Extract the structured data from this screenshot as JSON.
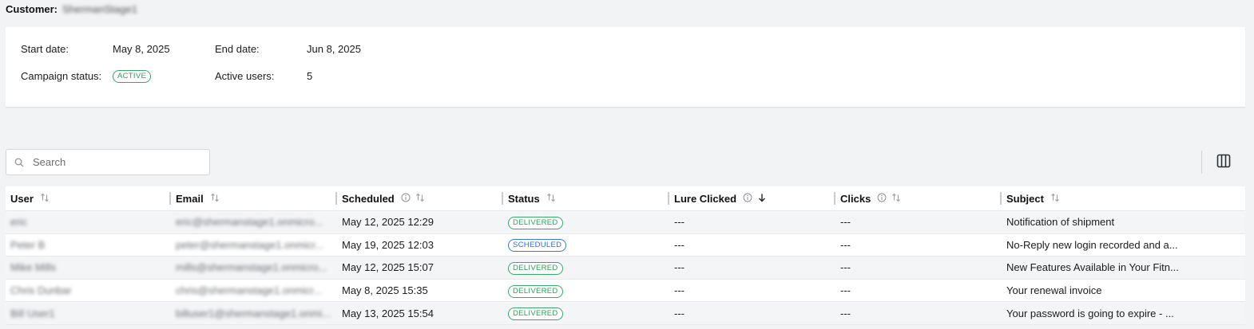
{
  "customer": {
    "label": "Customer:",
    "name": "ShermanStage1"
  },
  "summary": {
    "start_label": "Start date:",
    "start_value": "May 8, 2025",
    "end_label": "End date:",
    "end_value": "Jun 8, 2025",
    "status_label": "Campaign status:",
    "status_value": "ACTIVE",
    "active_users_label": "Active users:",
    "active_users_value": "5"
  },
  "search": {
    "placeholder": "Search"
  },
  "table": {
    "columns": [
      {
        "label": "User",
        "info": false,
        "sort": "none"
      },
      {
        "label": "Email",
        "info": false,
        "sort": "none"
      },
      {
        "label": "Scheduled",
        "info": true,
        "sort": "none"
      },
      {
        "label": "Status",
        "info": false,
        "sort": "none"
      },
      {
        "label": "Lure Clicked",
        "info": true,
        "sort": "desc"
      },
      {
        "label": "Clicks",
        "info": true,
        "sort": "none"
      },
      {
        "label": "Subject",
        "info": false,
        "sort": "none"
      }
    ],
    "rows": [
      {
        "user": "eric",
        "email": "eric@shermanstage1.onmicro...",
        "scheduled": "May 12, 2025 12:29",
        "status": "DELIVERED",
        "lure_clicked": "---",
        "clicks": "---",
        "subject": "Notification of shipment"
      },
      {
        "user": "Peter B",
        "email": "peter@shermanstage1.onmicr...",
        "scheduled": "May 19, 2025 12:03",
        "status": "SCHEDULED",
        "lure_clicked": "---",
        "clicks": "---",
        "subject": "No-Reply new login recorded and a..."
      },
      {
        "user": "Mike Mills",
        "email": "mills@shermanstage1.onmicro...",
        "scheduled": "May 12, 2025 15:07",
        "status": "DELIVERED",
        "lure_clicked": "---",
        "clicks": "---",
        "subject": "New Features Available in Your Fitn..."
      },
      {
        "user": "Chris Dunbar",
        "email": "chris@shermanstage1.onmicr...",
        "scheduled": "May 8, 2025 15:35",
        "status": "DELIVERED",
        "lure_clicked": "---",
        "clicks": "---",
        "subject": "Your renewal invoice"
      },
      {
        "user": "Bill User1",
        "email": "billuser1@shermanstage1.onmi...",
        "scheduled": "May 13, 2025 15:54",
        "status": "DELIVERED",
        "lure_clicked": "---",
        "clicks": "---",
        "subject": "Your password is going to expire - ..."
      }
    ]
  },
  "colors": {
    "delivered": "#2f9a5a",
    "scheduled": "#2c6fd1",
    "background": "#f2f3f5"
  },
  "icons": {
    "search": "search-icon",
    "columns": "columns-icon",
    "sort": "sort-icon",
    "info": "info-icon"
  }
}
